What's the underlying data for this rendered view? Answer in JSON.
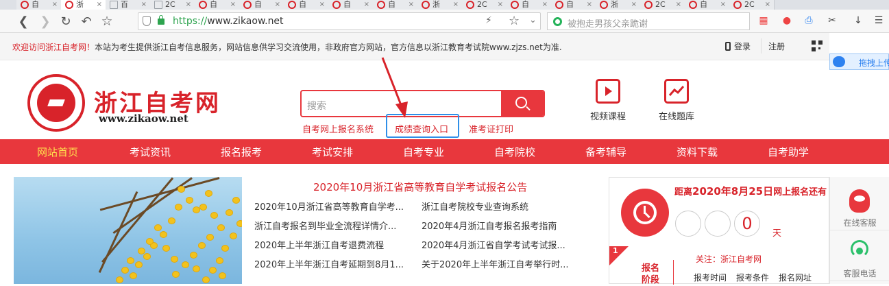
{
  "browser": {
    "tabs": [
      {
        "title": "自",
        "icon": "zikao-favicon"
      },
      {
        "title": "浙",
        "icon": "zikao-favicon",
        "active": true
      },
      {
        "title": "百",
        "icon": "doc-favicon"
      },
      {
        "title": "2C",
        "icon": "doc-favicon"
      },
      {
        "title": "自",
        "icon": "zikao-favicon"
      },
      {
        "title": "自",
        "icon": "zikao-favicon"
      },
      {
        "title": "自",
        "icon": "zikao-favicon"
      },
      {
        "title": "自",
        "icon": "zikao-favicon"
      },
      {
        "title": "自",
        "icon": "zikao-favicon"
      },
      {
        "title": "浙",
        "icon": "zikao-favicon"
      },
      {
        "title": "2C",
        "icon": "zikao-favicon"
      },
      {
        "title": "自",
        "icon": "zikao-favicon"
      },
      {
        "title": "自",
        "icon": "zikao-favicon"
      },
      {
        "title": "浙",
        "icon": "zikao-favicon"
      },
      {
        "title": "2C",
        "icon": "zikao-favicon"
      },
      {
        "title": "自",
        "icon": "zikao-favicon"
      },
      {
        "title": "2C",
        "icon": "zikao-favicon"
      }
    ],
    "url_scheme": "https://",
    "url_host": "www.zikaow.net",
    "search_placeholder": "被抱走男孩父亲跪谢",
    "toolbar_icons": [
      "back-icon",
      "forward-icon",
      "reload-icon",
      "undo-icon",
      "bookmark-star-icon",
      "apps-icon",
      "game-icon",
      "sync-icon",
      "scissors-icon",
      "download-icon",
      "menu-icon"
    ]
  },
  "notice": {
    "welcome": "欢迎访问浙江自考网！",
    "text": "本站为考生提供浙江自考信息服务，网站信息供学习交流使用，非政府官方网站，官方信息以浙江教育考试院www.zjzs.net为准.",
    "login": "登录",
    "register": "注册",
    "drag_button": "拖拽上传"
  },
  "header": {
    "logo_title": "浙江自考网",
    "logo_url": "www.zikaow.net",
    "search_placeholder": "搜索",
    "quick_links": [
      "自考网上报名系统",
      "成绩查询入口",
      "准考证打印"
    ],
    "features": [
      {
        "label": "视频课程",
        "icon": "video-course-icon"
      },
      {
        "label": "在线题库",
        "icon": "question-bank-icon"
      }
    ]
  },
  "nav": {
    "items": [
      "网站首页",
      "考试资讯",
      "报名报考",
      "考试安排",
      "自考专业",
      "自考院校",
      "备考辅导",
      "资料下载",
      "自考助学"
    ],
    "current": 0
  },
  "news": {
    "headline": "2020年10月浙江省高等教育自学考试报名公告",
    "items": [
      "2020年10月浙江省高等教育自学考...",
      "浙江自考院校专业查询系统",
      "浙江自考报名到毕业全流程详情介...",
      "2020年4月浙江自考报名报考指南",
      "2020年上半年浙江自考退费流程",
      "2020年4月浙江省自学考试考试报...",
      "2020年上半年浙江自考延期到8月1...",
      "关于2020年上半年浙江自考举行时..."
    ]
  },
  "countdown": {
    "prefix": "距离",
    "date": "2020年8月25日",
    "suffix": "网上报名还有",
    "digits": [
      "",
      "",
      "0"
    ],
    "unit": "天",
    "step_number": "1",
    "stage_label": "报名阶段",
    "follow": "关注：浙江自考网",
    "subitems": [
      "报考时间",
      "报考条件",
      "报名网址"
    ]
  },
  "sidebar": {
    "online_service": "在线客服",
    "phone_service": "客服电话"
  },
  "colors": {
    "brand_red": "#e8373d",
    "nav_current": "#ffe14d",
    "highlight_blue": "#2f8fe8",
    "url_green": "#2ea44f"
  }
}
